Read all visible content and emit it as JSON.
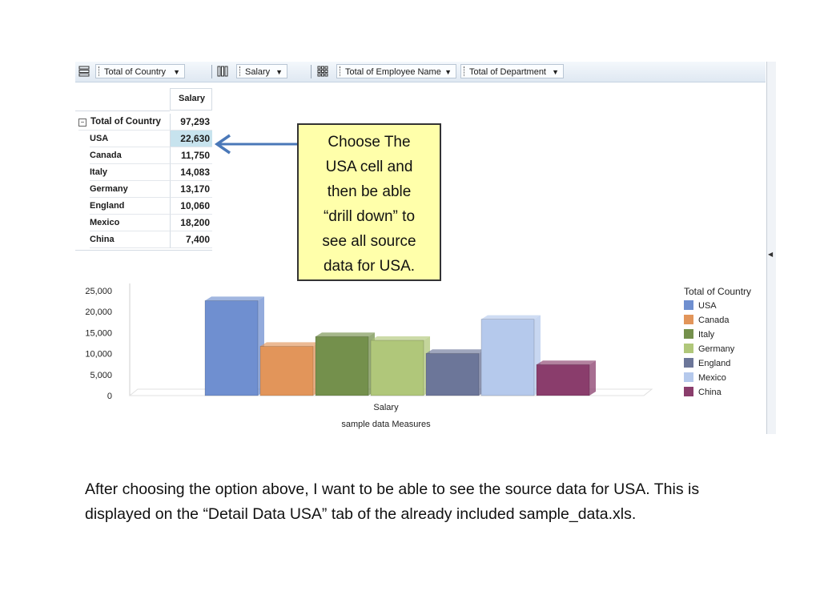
{
  "toolbar": {
    "rows_dropdown": "Total of Country",
    "columns_dropdown": "Salary",
    "filter_dropdown_1": "Total of Employee Name",
    "filter_dropdown_2": "Total of Department"
  },
  "pivot": {
    "column_header": "Salary",
    "total_label": "Total of Country",
    "total_value": "97,293",
    "rows": [
      {
        "label": "USA",
        "value": "22,630"
      },
      {
        "label": "Canada",
        "value": "11,750"
      },
      {
        "label": "Italy",
        "value": "14,083"
      },
      {
        "label": "Germany",
        "value": "13,170"
      },
      {
        "label": "England",
        "value": "10,060"
      },
      {
        "label": "Mexico",
        "value": "18,200"
      },
      {
        "label": "China",
        "value": "7,400"
      }
    ]
  },
  "callout": {
    "lines": [
      "Choose The",
      "USA cell and",
      "then be able",
      "“drill down” to",
      "see all source",
      "data for USA."
    ]
  },
  "chart_data": {
    "type": "bar",
    "categories": [
      "Salary"
    ],
    "xlabel": "Salary",
    "subtitle": "sample data Measures",
    "ylim": [
      0,
      25000
    ],
    "yticks": [
      "25,000",
      "20,000",
      "15,000",
      "10,000",
      "5,000",
      "0"
    ],
    "legend_title": "Total of Country",
    "legend_position": "right",
    "series": [
      {
        "name": "USA",
        "values": [
          22630
        ],
        "color": "#6f8fd0"
      },
      {
        "name": "Canada",
        "values": [
          11750
        ],
        "color": "#e2955a"
      },
      {
        "name": "Italy",
        "values": [
          14083
        ],
        "color": "#74904c"
      },
      {
        "name": "Germany",
        "values": [
          13170
        ],
        "color": "#b0c77a"
      },
      {
        "name": "England",
        "values": [
          10060
        ],
        "color": "#6c7699"
      },
      {
        "name": "Mexico",
        "values": [
          18200
        ],
        "color": "#b5c9ec"
      },
      {
        "name": "China",
        "values": [
          7400
        ],
        "color": "#8a3d6c"
      }
    ]
  },
  "body_text": "After choosing the option above, I want to be able to see the source data for USA.  This is displayed on the “Detail Data USA” tab of the already included sample_data.xls."
}
